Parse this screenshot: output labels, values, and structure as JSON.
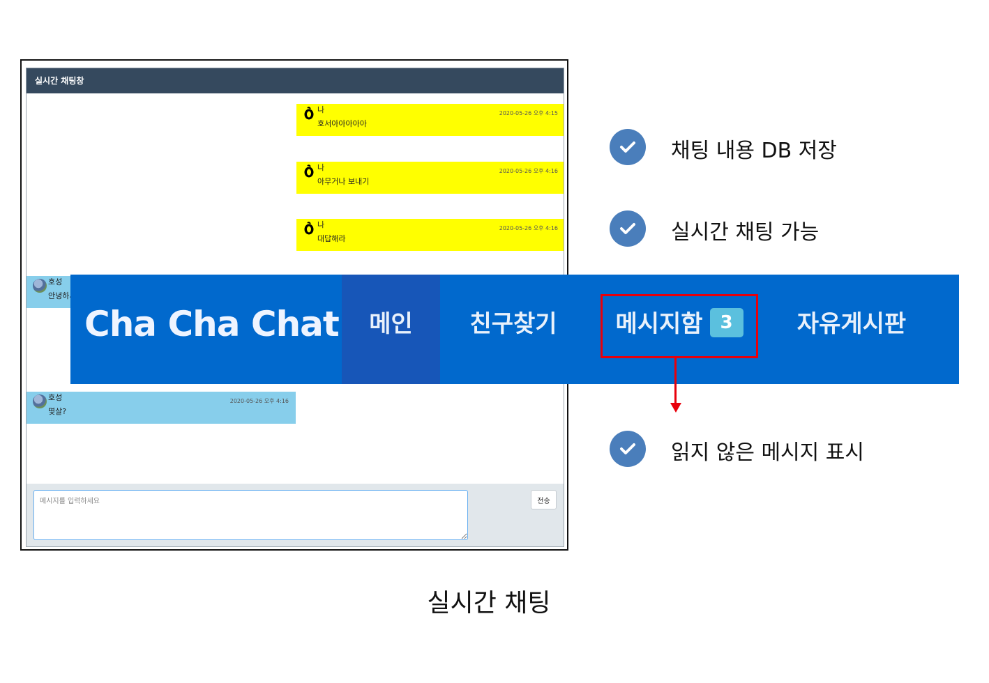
{
  "chat": {
    "header_title": "실시간 채팅창",
    "messages": [
      {
        "side": "mine",
        "sender": "나",
        "text": "호서아아아아아",
        "time": "2020-05-26 오후 4:15"
      },
      {
        "side": "mine",
        "sender": "나",
        "text": "아무거나 보내기",
        "time": "2020-05-26 오후 4:16"
      },
      {
        "side": "mine",
        "sender": "나",
        "text": "대답해라",
        "time": "2020-05-26 오후 4:16"
      },
      {
        "side": "theirs",
        "sender": "호성",
        "text": "안녕하세",
        "time": ""
      },
      {
        "side": "theirs",
        "sender": "호성",
        "text": "몇살?",
        "time": "2020-05-26 오후 4:16"
      }
    ],
    "input_placeholder": "메시지를 입력하세요",
    "send_label": "전송"
  },
  "navbar": {
    "brand": "Cha Cha Chat",
    "items": [
      {
        "label": "메인"
      },
      {
        "label": "친구찾기"
      },
      {
        "label": "메시지함",
        "badge": "3"
      },
      {
        "label": "자유게시판"
      }
    ],
    "background_color": "#0169cd",
    "active_color": "#1756b8",
    "badge_color": "#5bc0de"
  },
  "features": [
    {
      "text": "채팅 내용 DB 저장",
      "icon": "check-icon"
    },
    {
      "text": "실시간 채팅 가능",
      "icon": "check-icon"
    },
    {
      "text": "읽지 않은 메시지 표시",
      "icon": "check-icon"
    }
  ],
  "caption": "실시간 채팅",
  "colors": {
    "highlight": "#e8000b",
    "check_circle": "#4a7ebb",
    "my_message": "#ffff00",
    "their_message": "#87ceeb",
    "chat_header": "#35495e"
  }
}
